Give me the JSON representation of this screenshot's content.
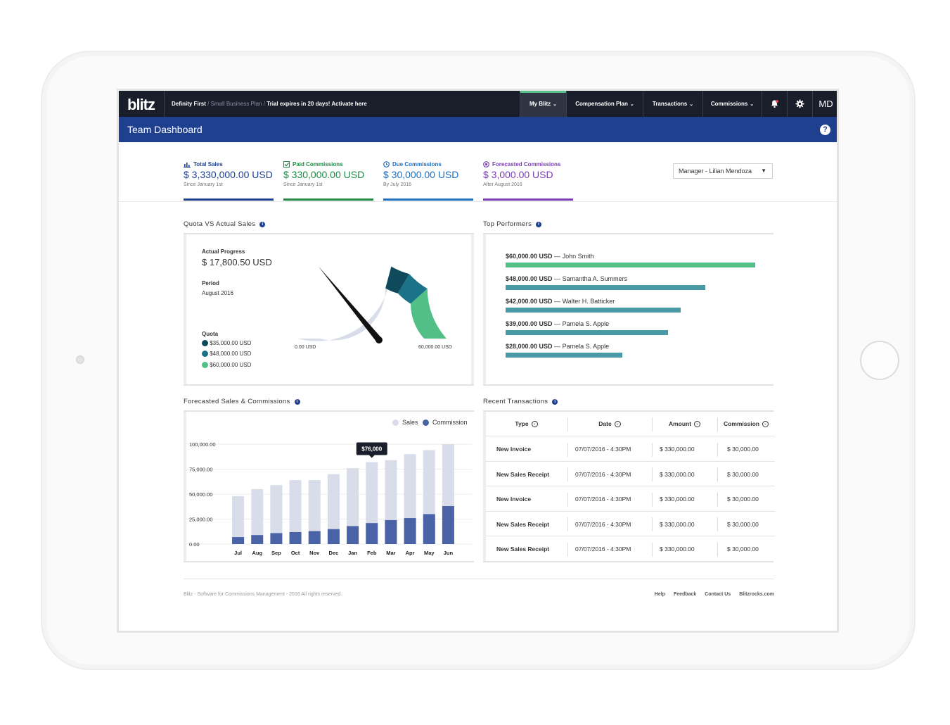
{
  "app": {
    "logo": "blitz",
    "company": "Definity First",
    "plan": "Small Business Plan",
    "trial": "Trial expires in 20 days! Activate here",
    "user_initials": "MD"
  },
  "nav": {
    "items": [
      {
        "label": "My Blitz",
        "active": true
      },
      {
        "label": "Compensation Plan"
      },
      {
        "label": "Transactions"
      },
      {
        "label": "Commissions"
      }
    ],
    "icons": [
      "bell-icon",
      "gear-icon"
    ]
  },
  "page": {
    "title": "Team Dashboard"
  },
  "stats": [
    {
      "label": "Total Sales",
      "value": "$ 3,330,000.00 USD",
      "sub": "Since January 1st",
      "color": "#1f3f8f",
      "icon": "bar-chart-icon"
    },
    {
      "label": "Paid Commissions",
      "value": "$ 330,000.00 USD",
      "sub": "Since January 1st",
      "color": "#1e8a45",
      "icon": "check-icon"
    },
    {
      "label": "Due Commissions",
      "value": "$ 30,000.00 USD",
      "sub": "By July 2016",
      "color": "#1f6fbf",
      "icon": "clock-icon"
    },
    {
      "label": "Forecasted Commissions",
      "value": "$ 3,000.00 USD",
      "sub": "After August 2016",
      "color": "#7b3fb5",
      "icon": "forecast-icon"
    }
  ],
  "manager_select": {
    "value": "Manager - Lilian Mendoza"
  },
  "quota": {
    "title": "Quota VS Actual Sales",
    "progress_label": "Actual Progress",
    "progress_value": "$ 17,800.50 USD",
    "period_label": "Period",
    "period_value": "August 2016",
    "quota_label": "Quota",
    "levels": [
      {
        "label": "$35,000.00 USD",
        "color": "#0f4a5c"
      },
      {
        "label": "$48,000.00 USD",
        "color": "#1b7389"
      },
      {
        "label": "$60,000.00 USD",
        "color": "#52bf87"
      }
    ],
    "gauge": {
      "min_label": "0.00 USD",
      "max_label": "60,000.00 USD",
      "value": 17800.5,
      "max": 60000
    }
  },
  "top_performers": {
    "title": "Top Performers",
    "rows": [
      {
        "amount": "$60,000.00 USD",
        "name": "John Smith",
        "value": 60000,
        "color": "#52bf87"
      },
      {
        "amount": "$48,000.00 USD",
        "name": "Samantha A. Summers",
        "value": 48000,
        "color": "#4a9aa5"
      },
      {
        "amount": "$42,000.00 USD",
        "name": "Walter H. Batticker",
        "value": 42000,
        "color": "#4a9aa5"
      },
      {
        "amount": "$39,000.00 USD",
        "name": "Pamela S. Apple",
        "value": 39000,
        "color": "#4a9aa5"
      },
      {
        "amount": "$28,000.00 USD",
        "name": "Pamela S. Apple",
        "value": 28000,
        "color": "#4a9aa5"
      }
    ]
  },
  "forecast": {
    "title": "Forecasted Sales & Commissions",
    "legend_sales": "Sales",
    "legend_commission": "Commission",
    "tooltip": "$76,000"
  },
  "chart_data": {
    "type": "bar",
    "categories": [
      "Jul",
      "Aug",
      "Sep",
      "Oct",
      "Nov",
      "Dec",
      "Jan",
      "Feb",
      "Mar",
      "Apr",
      "May",
      "Jun"
    ],
    "series": [
      {
        "name": "Sales",
        "color": "#d8dde9",
        "values": [
          48000,
          55000,
          59000,
          64000,
          64000,
          70000,
          76000,
          82000,
          84000,
          90000,
          94000,
          100000
        ]
      },
      {
        "name": "Commission",
        "color": "#4a62a6",
        "values": [
          7000,
          9000,
          11000,
          12000,
          13000,
          15000,
          18000,
          21000,
          24000,
          26000,
          30000,
          38000
        ]
      }
    ],
    "y_ticks": [
      "100,000.00",
      "75,000.00",
      "50,000.00",
      "25,000.00",
      "0.00"
    ],
    "ylim": [
      0,
      100000
    ],
    "grid": true,
    "legend": "top-right",
    "annotation": {
      "category": "Feb",
      "text": "$76,000"
    }
  },
  "transactions": {
    "title": "Recent Transactions",
    "columns": [
      "Type",
      "Date",
      "Amount",
      "Commission"
    ],
    "rows": [
      {
        "type": "New Invoice",
        "date": "07/07/2016 - 4:30PM",
        "amount": "$ 330,000.00",
        "commission": "$ 30,000.00"
      },
      {
        "type": "New Sales Receipt",
        "date": "07/07/2016 - 4:30PM",
        "amount": "$ 330,000.00",
        "commission": "$ 30,000.00"
      },
      {
        "type": "New Invoice",
        "date": "07/07/2016 - 4:30PM",
        "amount": "$ 330,000.00",
        "commission": "$ 30,000.00"
      },
      {
        "type": "New Sales Receipt",
        "date": "07/07/2016 - 4:30PM",
        "amount": "$ 330,000.00",
        "commission": "$ 30,000.00"
      },
      {
        "type": "New Sales Receipt",
        "date": "07/07/2016 - 4:30PM",
        "amount": "$ 330,000.00",
        "commission": "$ 30,000.00"
      }
    ]
  },
  "footer": {
    "copyright": "Blitz - Software for Commissions Management - 2016 All rights reserved.",
    "links": [
      "Help",
      "Feedback",
      "Contact Us",
      "Blitzrocks.com"
    ]
  }
}
